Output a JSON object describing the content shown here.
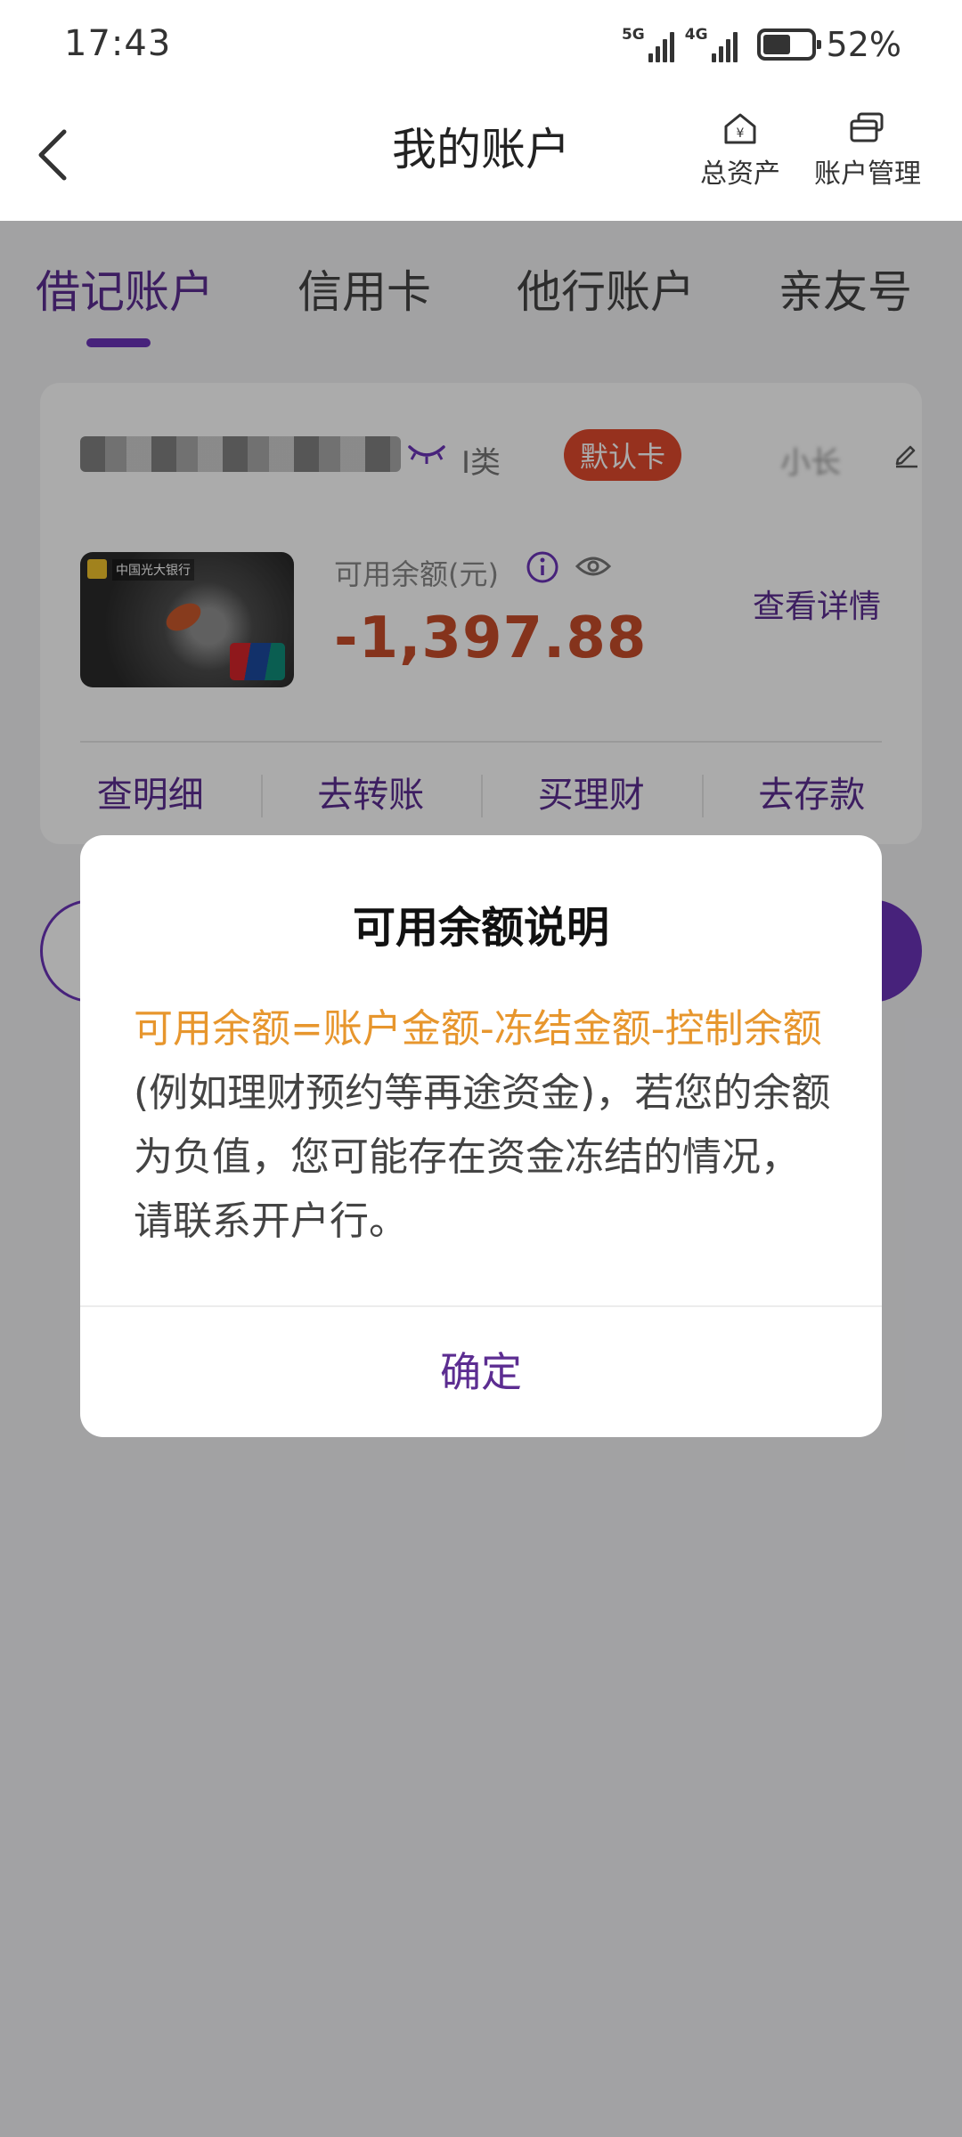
{
  "status_bar": {
    "time": "17:43",
    "network_1": "5G",
    "network_2": "4G",
    "battery": "52%"
  },
  "header": {
    "title": "我的账户",
    "back_icon": "chevron-left-icon",
    "actions": [
      {
        "label": "总资产",
        "icon": "house-yen-icon"
      },
      {
        "label": "账户管理",
        "icon": "cards-icon"
      }
    ]
  },
  "tabs": [
    {
      "label": "借记账户",
      "active": true
    },
    {
      "label": "信用卡",
      "active": false
    },
    {
      "label": "他行账户",
      "active": false
    },
    {
      "label": "亲友号",
      "active": false
    }
  ],
  "account_card": {
    "account_class": "I类",
    "default_badge": "默认卡",
    "nickname": "小长",
    "card_bank_name": "中国光大银行",
    "balance_label": "可用余额(元)",
    "balance": "-1,397.88",
    "detail_link": "查看详情",
    "actions": [
      "查明细",
      "去转账",
      "买理财",
      "去存款"
    ]
  },
  "dialog": {
    "title": "可用余额说明",
    "body_highlight": "可用余额=账户金额-冻结金额-控制余额",
    "body_rest": "(例如理财预约等再途资金)，若您的余额为负值，您可能存在资金冻结的情况，请联系开户行。",
    "confirm": "确定"
  },
  "colors": {
    "brand_purple": "#5c2d91",
    "balance_red": "#c74c2a",
    "highlight_orange": "#e7962d",
    "badge_red": "#e04a2e"
  }
}
